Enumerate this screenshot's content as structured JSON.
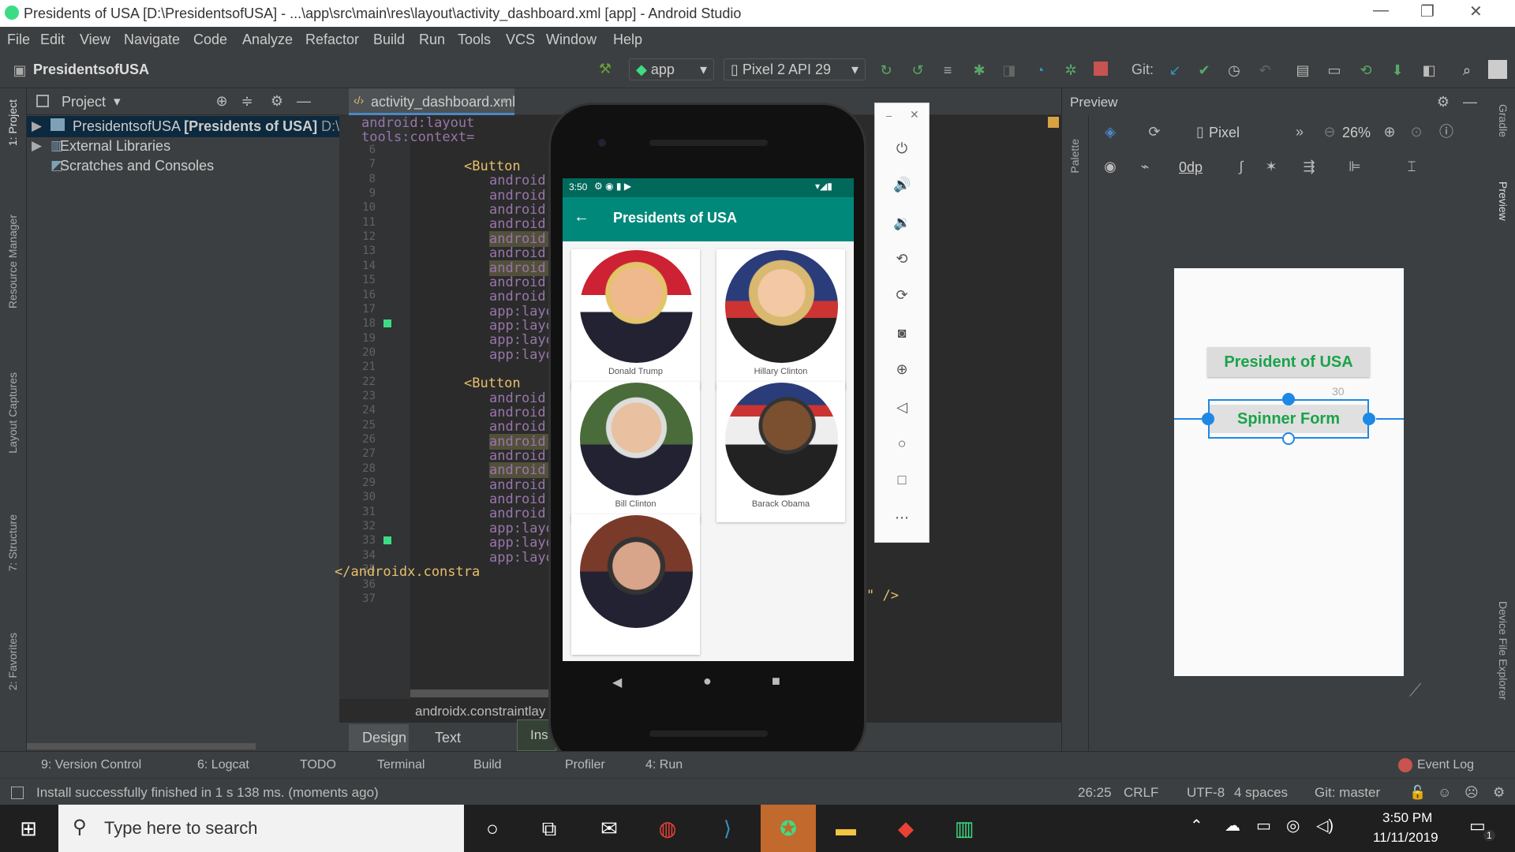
{
  "window": {
    "title": "Presidents of USA [D:\\PresidentsofUSA] - ...\\app\\src\\main\\res\\layout\\activity_dashboard.xml [app] - Android Studio"
  },
  "menu": [
    "File",
    "Edit",
    "View",
    "Navigate",
    "Code",
    "Analyze",
    "Refactor",
    "Build",
    "Run",
    "Tools",
    "VCS",
    "Window",
    "Help"
  ],
  "toolbar": {
    "project_name": "PresidentsofUSA",
    "module": "app",
    "device": "Pixel 2 API 29",
    "git_label": "Git:"
  },
  "project_panel": {
    "title": "Project",
    "items": [
      {
        "label": "PresidentsofUSA",
        "bold": "[Presidents of USA]",
        "path": "D:\\"
      },
      {
        "label": "External Libraries"
      },
      {
        "label": "Scratches and Consoles"
      }
    ]
  },
  "left_tools": [
    "1: Project",
    "Resource Manager",
    "Layout Captures",
    "7: Structure",
    "2: Favorites"
  ],
  "editor": {
    "tab": "activity_dashboard.xml",
    "breadcrumb": "androidx.constraintlay",
    "lines": [
      {
        "n": "6",
        "t": "android:layout"
      },
      {
        "n": "7",
        "t": "tools:context="
      },
      {
        "n": "8",
        "t": ""
      },
      {
        "n": "9",
        "t": "<Button"
      },
      {
        "n": "10",
        "t": "android:id"
      },
      {
        "n": "11",
        "t": "android:la"
      },
      {
        "n": "12",
        "t": "android:la"
      },
      {
        "n": "13",
        "t": "android:la"
      },
      {
        "n": "14",
        "t": "android:te"
      },
      {
        "n": "15",
        "t": "android:te"
      },
      {
        "n": "16",
        "t": "android:te"
      },
      {
        "n": "17",
        "t": "android:te"
      },
      {
        "n": "18",
        "t": "android:te"
      },
      {
        "n": "19",
        "t": "app:layout"
      },
      {
        "n": "20",
        "t": "app:layout"
      },
      {
        "n": "21",
        "t": "app:layout"
      },
      {
        "n": "22",
        "t": "app:layout"
      },
      {
        "n": "23",
        "t": ""
      },
      {
        "n": "24",
        "t": "<Button"
      },
      {
        "n": "25",
        "t": "android:id"
      },
      {
        "n": "26",
        "t": "android:la"
      },
      {
        "n": "27",
        "t": "android:la"
      },
      {
        "n": "28",
        "t": "android:la"
      },
      {
        "n": "29",
        "t": "android:te"
      },
      {
        "n": "30",
        "t": "android:te"
      },
      {
        "n": "31",
        "t": "android:te"
      },
      {
        "n": "32",
        "t": "android:te"
      },
      {
        "n": "33",
        "t": "android:te"
      },
      {
        "n": "34",
        "t": "app:layout"
      },
      {
        "n": "35",
        "t": "app:layout"
      },
      {
        "n": "36",
        "t": "app:layout"
      },
      {
        "n": "37",
        "t": "</androidx.constra"
      }
    ],
    "tail": "\" />"
  },
  "design_tabs": {
    "design": "Design",
    "text": "Text",
    "ins": "Ins"
  },
  "preview": {
    "title": "Preview",
    "device": "Pixel",
    "zoom": "26%",
    "margin": "0dp",
    "btn1": "President of USA",
    "btn2": "Spinner Form",
    "dim": "30",
    "palette": "Palette"
  },
  "right_tools": [
    "Gradle",
    "Preview",
    "Device File Explorer"
  ],
  "phone": {
    "time": "3:50",
    "app_title": "Presidents of USA",
    "presidents": [
      "Donald Trump",
      "Hillary Clinton",
      "Bill Clinton",
      "Barack Obama",
      ""
    ]
  },
  "bottom_tabs": [
    "9: Version Control",
    "6: Logcat",
    "TODO",
    "Terminal",
    "Build",
    "Profiler",
    "4: Run",
    "Event Log"
  ],
  "status": {
    "message": "Install successfully finished in 1 s 138 ms. (moments ago)",
    "pos": "26:25",
    "crlf": "CRLF",
    "enc": "UTF-8",
    "indent": "4 spaces",
    "git": "Git: master"
  },
  "taskbar": {
    "search": "Type here to search",
    "time": "3:50 PM",
    "date": "11/11/2019",
    "notif": "1"
  },
  "colors": {
    "accent": "#00897b",
    "green": "#1aa34a"
  }
}
